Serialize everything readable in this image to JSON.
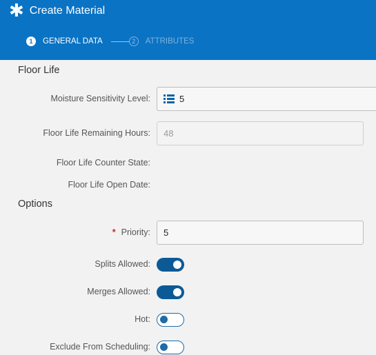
{
  "header": {
    "icon": "asterisk-icon",
    "title": "Create Material",
    "background_color": "#0a73c4"
  },
  "steps": [
    {
      "number": "1",
      "label": "GENERAL DATA",
      "active": true
    },
    {
      "number": "2",
      "label": "ATTRIBUTES",
      "active": false
    }
  ],
  "floor_life": {
    "section_title": "Floor Life",
    "msl_label": "Moisture Sensitivity Level:",
    "msl_value": "5",
    "msl_icon": "list-icon",
    "remaining_hours_label": "Floor Life Remaining Hours:",
    "remaining_hours_value": "48",
    "counter_state_label": "Floor Life Counter State:",
    "open_date_label": "Floor Life Open Date:"
  },
  "options": {
    "section_title": "Options",
    "required_marker": "*",
    "priority_label": "Priority:",
    "priority_value": "5",
    "splits_label": "Splits Allowed:",
    "splits_on": true,
    "merges_label": "Merges Allowed:",
    "merges_on": true,
    "hot_label": "Hot:",
    "hot_on": false,
    "exclude_label": "Exclude From Scheduling:",
    "exclude_on": false
  },
  "colors": {
    "accent": "#0b5a96",
    "required": "#c0282d"
  }
}
